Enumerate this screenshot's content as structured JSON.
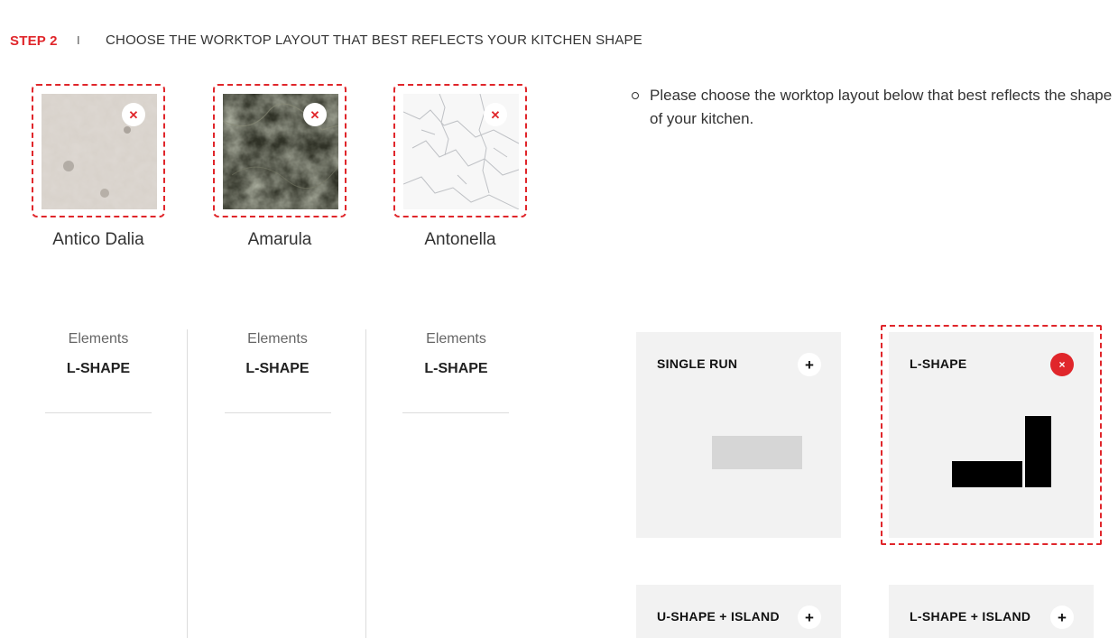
{
  "header": {
    "step_label": "STEP 2",
    "separator": "I",
    "title": "CHOOSE THE WORKTOP LAYOUT THAT BEST REFLECTS YOUR KITCHEN SHAPE"
  },
  "swatches": [
    {
      "name": "Antico Dalia",
      "remove_icon": "close-icon"
    },
    {
      "name": "Amarula",
      "remove_icon": "close-icon"
    },
    {
      "name": "Antonella",
      "remove_icon": "close-icon"
    }
  ],
  "info": {
    "text": "Please choose the worktop layout below that best reflects the shape of your kitchen."
  },
  "element_columns": [
    {
      "label": "Elements",
      "value": "L-SHAPE"
    },
    {
      "label": "Elements",
      "value": "L-SHAPE"
    },
    {
      "label": "Elements",
      "value": "L-SHAPE"
    }
  ],
  "layouts": [
    {
      "title": "SINGLE RUN",
      "button": "+",
      "selected": false
    },
    {
      "title": "L-SHAPE",
      "button": "×",
      "selected": true
    },
    {
      "title": "U-SHAPE + ISLAND",
      "button": "+",
      "selected": false
    },
    {
      "title": "L-SHAPE + ISLAND",
      "button": "+",
      "selected": false
    }
  ],
  "colors": {
    "accent": "#e0262b",
    "card_background": "#f2f2f2",
    "shape_inactive": "#d6d6d6",
    "shape_active": "#000000"
  }
}
